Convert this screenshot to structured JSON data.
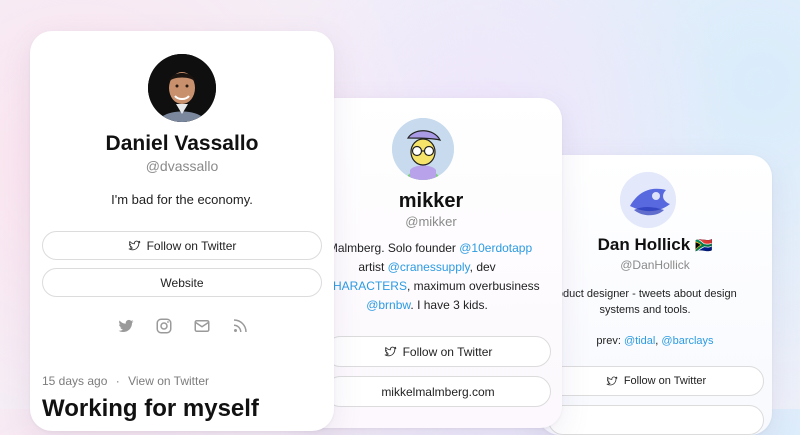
{
  "cards": [
    {
      "name": "Daniel Vassallo",
      "handle": "@dvassallo",
      "bio": "I'm bad for the economy.",
      "follow_label": "Follow on Twitter",
      "website_label": "Website",
      "post_meta_date": "15 days ago",
      "post_meta_sep": "·",
      "post_meta_link": "View on Twitter",
      "post_title": "Working for myself"
    },
    {
      "name": "mikker",
      "handle": "@mikker",
      "bio": {
        "line1_a": "l Malmberg. Solo founder ",
        "line1_link": "@10erdotapp",
        "line2_a": "artist ",
        "line2_link": "@cranessupply",
        "line2_b": ", dev",
        "line3_link": "MCHARACTERS",
        "line3_b": ", maximum overbusiness",
        "line4_link": "@brnbw",
        "line4_b": ". I have 3 kids."
      },
      "follow_label": "Follow on Twitter",
      "website_label": "mikkelmalmberg.com"
    },
    {
      "name": "Dan Hollick",
      "flag": "🇿🇦",
      "handle": "@DanHollick",
      "bio_line1": "roduct designer - tweets about design",
      "bio_line2": "systems and tools.",
      "prev_label": "prev: ",
      "prev_link1": "@tidal",
      "prev_sep": ", ",
      "prev_link2": "@barclays",
      "follow_label": "Follow on Twitter"
    }
  ],
  "colors": {
    "link": "#2c9be2",
    "icon_gray": "#9a9a9a"
  }
}
